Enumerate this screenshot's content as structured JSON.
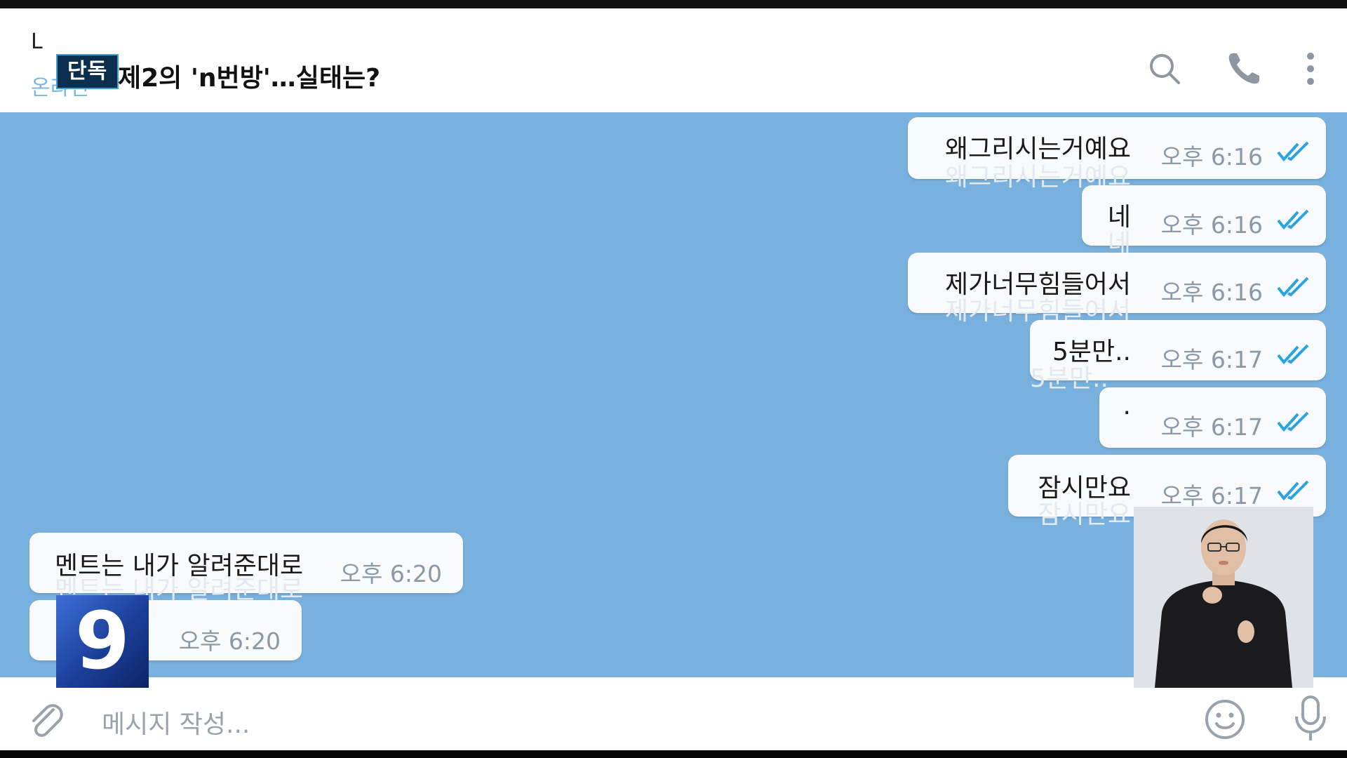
{
  "header": {
    "chat_name": "L",
    "status": "온라인",
    "badge": "단독",
    "headline": "제2의 'n번방'…실태는?",
    "icons": [
      "search-icon",
      "phone-icon",
      "more-vert-icon"
    ]
  },
  "messages": [
    {
      "direction": "out",
      "text": "왜그리시는거예요",
      "time": "오후 6:16",
      "status": "read"
    },
    {
      "direction": "out",
      "text": "네",
      "time": "오후 6:16",
      "status": "read"
    },
    {
      "direction": "out",
      "text": "제가너무힘들어서",
      "time": "오후 6:16",
      "status": "read"
    },
    {
      "direction": "out",
      "text": "5분만..",
      "time": "오후 6:17",
      "status": "read"
    },
    {
      "direction": "out",
      "text": "·",
      "time": "오후 6:17",
      "status": "read"
    },
    {
      "direction": "out",
      "text": "잠시만요",
      "time": "오후 6:17",
      "status": "read"
    },
    {
      "direction": "in",
      "text": "멘트는 내가 알려준대로",
      "time": "오후 6:20"
    },
    {
      "direction": "in",
      "text": "",
      "time": "오후 6:20"
    }
  ],
  "input": {
    "placeholder": "메시지 작성...",
    "icons": [
      "attach-icon",
      "emoji-icon",
      "mic-icon"
    ]
  },
  "overlay": {
    "channel_logo": "9"
  },
  "colors": {
    "chat_background": "#79b1de",
    "bubble": "#f8fafc",
    "read_check": "#2aa3e0",
    "badge_bg": "#0b2e4d"
  }
}
